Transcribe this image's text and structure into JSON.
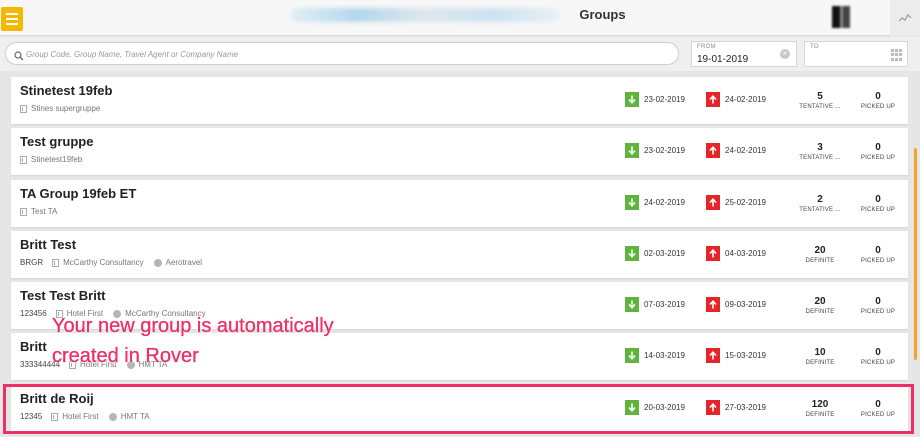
{
  "header": {
    "title": "Groups",
    "icons": {
      "menu": "hamburger-menu-icon",
      "activity": "activity-chart-icon"
    },
    "colors": {
      "menu_button": "#f5b800"
    }
  },
  "search": {
    "placeholder": "Group Code, Group Name, Travel Agent or Company Name",
    "value": ""
  },
  "date_filter": {
    "from_label": "FROM",
    "from_value": "19-01-2019",
    "to_label": "TO",
    "to_value": ""
  },
  "groups": [
    {
      "name": "Stinetest 19feb",
      "code": "",
      "company": "Stines supergruppe",
      "agent": "",
      "arrival": "23-02-2019",
      "departure": "24-02-2019",
      "rooms": "5",
      "status": "TENTATIVE ...",
      "picked_up": "0",
      "picked_label": "PICKED UP"
    },
    {
      "name": "Test gruppe",
      "code": "",
      "company": "Stinetest19feb",
      "agent": "",
      "arrival": "23-02-2019",
      "departure": "24-02-2019",
      "rooms": "3",
      "status": "TENTATIVE ...",
      "picked_up": "0",
      "picked_label": "PICKED UP"
    },
    {
      "name": "TA Group 19feb ET",
      "code": "",
      "company": "Test TA",
      "agent": "",
      "arrival": "24-02-2019",
      "departure": "25-02-2019",
      "rooms": "2",
      "status": "TENTATIVE ...",
      "picked_up": "0",
      "picked_label": "PICKED UP"
    },
    {
      "name": "Britt Test",
      "code": "BRGR",
      "company": "McCarthy Consultancy",
      "agent": "Aerotravel",
      "arrival": "02-03-2019",
      "departure": "04-03-2019",
      "rooms": "20",
      "status": "DEFINITE",
      "picked_up": "0",
      "picked_label": "PICKED UP"
    },
    {
      "name": "Test Test Britt",
      "code": "123456",
      "company": "Hotel First",
      "agent": "McCarthy Consultancy",
      "arrival": "07-03-2019",
      "departure": "09-03-2019",
      "rooms": "20",
      "status": "DEFINITE",
      "picked_up": "0",
      "picked_label": "PICKED UP"
    },
    {
      "name": "Britt",
      "code": "333344444",
      "company": "Hotel First",
      "agent": "HMT TA",
      "arrival": "14-03-2019",
      "departure": "15-03-2019",
      "rooms": "10",
      "status": "DEFINITE",
      "picked_up": "0",
      "picked_label": "PICKED UP"
    },
    {
      "name": "Britt de Roij",
      "code": "12345",
      "company": "Hotel First",
      "agent": "HMT TA",
      "arrival": "20-03-2019",
      "departure": "27-03-2019",
      "rooms": "120",
      "status": "DEFINITE",
      "picked_up": "0",
      "picked_label": "PICKED UP"
    }
  ],
  "colors": {
    "arrival": "#5fb43d",
    "departure": "#e5252a",
    "highlight": "#ee2f63",
    "scroll": "#f3a32a"
  },
  "annotation": {
    "text": "Your new group is automatically\ncreated in Rover"
  }
}
